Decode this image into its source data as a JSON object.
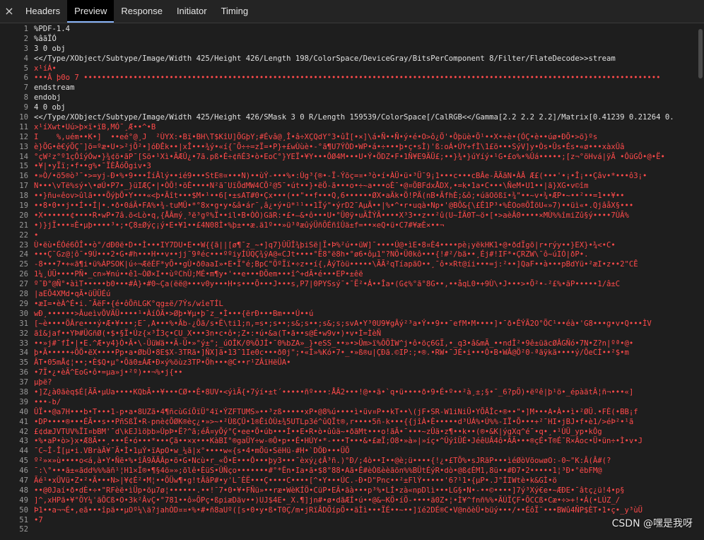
{
  "tabs": {
    "close": "×",
    "headers": "Headers",
    "preview": "Preview",
    "response": "Response",
    "initiator": "Initiator",
    "timing": "Timing"
  },
  "lines": [
    {
      "n": "1",
      "t": "%PDF-1.4"
    },
    {
      "n": "2",
      "t": "%âãÏÓ"
    },
    {
      "n": "3",
      "t": "3 0 obj"
    },
    {
      "n": "4",
      "t": "<</Type/XObject/Subtype/Image/Width 425/Height 426/Length 198/ColorSpace/DeviceGray/BitsPerComponent 8/Filter/FlateDecode>>stream"
    },
    {
      "n": "5",
      "t": "x¹íÁ•",
      "c": "red"
    },
    {
      "n": "6",
      "t": "•••Â þ0o 7 ••••••••••••••••••••••••••••••••••••••••••••••••••••••••••••••••••••••••••••••••••••••••••••••••••••••••••••••••••••••••••••••••",
      "c": "red"
    },
    {
      "n": "7",
      "t": "endstream"
    },
    {
      "n": "8",
      "t": "endobj"
    },
    {
      "n": "9",
      "t": "4 0 obj"
    },
    {
      "n": "10",
      "t": "<</Type/XObject/Subtype/Image/Width 425/Height 426/SMask 3 0 R/Length 159539/ColorSpace[/CalRGB<</Gamma[2.2 2.2 2.2]/Matrix[0.41239 0.21264 0."
    },
    {
      "n": "11",
      "t": "x¹íXwt•Uú>þ×ï•ïB,MÓ¯¸Æ••^•B",
      "c": "red"
    },
    {
      "n": "12",
      "t": "I    %,uém••K•]  ••eé°@¸J  ²ÙYX:•Bï•BH\\T$KîU]ÕGþY;#Évâ@¸Î•â÷XÇQdY°3•ûÌ[•×]\\á•Ñ••Ñ•ý•é•O>ô¿Ö'•Ôþüè•Ö¹••X•+è•{ÓÇ•è••úø•ÐÕ•>ö}ºs",
      "c": "red"
    },
    {
      "n": "13",
      "t": "è}ÕG•ê€ýÕÇ¯]õ=ºæ•U•>²jÕ²•]óÐÊk••|xÎ•••¾ý•«í{¯Õ÷÷=zÏ=•P}+£wÙùè•-°ã¶U7ÝÒD•WP•á•÷•••þ•ç•sÌ)'ß:oÁ•ÚY+fÌ\\1£ö•••SýV]y•Òs•Ûs•És•«ø•••xàxÛâ",
      "c": "red"
    },
    {
      "n": "14",
      "t": "°çW²z°º1çÔîýÓw•}¾¢ö•ãP¯[Sö•¹Xì•ÃÆÛ¿•7ã.pß•É÷¢ñÉ3•ò•EoC°}YEÏ•¥Y•••ÔØ4M•••U•Ý•ÖDZ•F•1Ñ¥E9ÄÜ£;••}¾•}úYíý•¹G•£o%•%Ûá•••••;[z¬°öHvá|ÿÃ •ÔüGÕ•@•Ë•",
      "c": "red"
    },
    {
      "n": "15",
      "t": "•¥|•yÏï;•f••g%•¯ÏÈÅóÕgiv•3",
      "c": "red"
    },
    {
      "n": "16",
      "t": "•»Ò/•ö5®ò³¯•>=yj-Ð•%•9•••ÍíÂlý••ié9•••StE®¤•••N)••ùÝ-•••%•:Ùg³{®•-Ï-Ýõç=¤•³ò•í•ÀÜ•ü•³Ü¯9¡1•••c•••cBÂe-ÃÃãN•ÀÂ Æ£(•••'•¡•Î¡••Çâv•*•••ô3¡•",
      "c": "red"
    },
    {
      "n": "17",
      "t": "N•••\\vTë%sý•\\•øÚ•P7•_}üIÆÇ•|•ÒÕ!•öÈ••••N²ã¯UïÕdMW4CÕ²@5¯•út••}•ëÖ-ã•••o•÷~a•••oÈ¯•@¤ÕBFdxÅDX,•=k•1a•C•••\\ÑeM•U1••|ã}XG•v©îm",
      "c": "red"
    },
    {
      "n": "18",
      "t": "••}ñu«êov>ûlã•••ÕýþÕ•Y•••«<þ•Ãît•••$M•¹••6[•±sAT#0•Çx•••(••\"••f•••Q,6••••••ØX•aÄk•Ö!PÄ(nB•ÃfhÈ;&ô;•úãOõßï•¾\"••~v•¾•ÆP•~••²••=1••¥••",
      "c": "red"
    },
    {
      "n": "19",
      "t": "••8•0••j••Í••Í|•.•ð•0áÃ•FA%•¾-tuMÜ•*°8x•g•y•&â•ár¯,â¿•ý•ü*¹¹••1Ïý\"•ýrD2¯AµÄ••|%•^•r•uqà•Np•'@BÕ&{\\£Ê1P³•%ÈOo®ÕÎõU«»7)••üì«•.QjâåX§•••",
      "c": "red"
    },
    {
      "n": "20",
      "t": "•X••••••¢••••R•wP•7â.õ<Lò•q,{ÅÂmý¸³ë³gº%Ï••il•B•ÒÒ)GãR:•£•–&•ô•••U•°Ü0ÿ•uÃÎÝÃ••••X³3••z••²û(U~ÍÃ0T~ö•[•>aèÂ0••••×MÙ%%îmiZû§ý••••7ÙÃ%",
      "c": "red"
    },
    {
      "n": "21",
      "t": "•)}jÏ•••¤È•µþ••••³•;•Ç8±Øýç¡ý•E•¥1••£4N08Ì•%þ±••æ.ä1º••»ü³ªæûýÜñÕÉñîÛä±f=••×eQ•ü•C7#¥æÈ×••¬",
      "c": "red"
    },
    {
      "n": "22",
      "t": "•",
      "c": "red"
    },
    {
      "n": "23",
      "t": "Ù•ëù•ÉÓé6ÔÎ••ò°/dÐ0ë•D••Ì•••IY7DU•E••W{{ã||[ø¶¯z_~•]q7}ÛÜÎ¾þiSë|Ï•Þ%²ú••üW]¯••••Ú@•ìE•8¤È4••••pè¡yëkHK1•@•ðdÏgõ|r•rýy••}EX}•¾<•C•",
      "c": "red"
    },
    {
      "n": "24",
      "t": "•••Ç¯Gz@¦ô¯•9Ú•••2•G•#h•••H••v••jj¯9ªéc•••ººiyÍÚQÇ¾ÿA@«CJt••••°Ë8°ë8h•°ø6•ôµ1\"?NÖ•Ü0kô•••{!#²/bã••¸Éj#!IF*•ÇRZW\\¯ô~úIÓ|ðP•.",
      "c": "red"
    },
    {
      "n": "25",
      "t": "-8•••7•+«ã¶i•ü%ÀPSOK|ú÷¬ÆëÉF*yÕ••gÙ•ð0aaI»•E•Ï°é;BpC\"ÖºÏï•÷z••í{,ÀýTòü•••••\\ÃÃ²qTíapãO••¸¯ô•×Rt@íi•••=j:²••]QaF••à•••pBdYü•²æI•z••2\"CÊ",
      "c": "red"
    },
    {
      "n": "26",
      "t": "1¼¸ÚÜ••••PÑ•_cn»¥nú••ê1~ÒØ×I••ùºChÛ;MÉ•m¶y•'••e•••ÐÖem•••î^+dÃ•é•••EP•±êë",
      "c": "red"
    },
    {
      "n": "27",
      "t": "º¯Ð°@Ñ°•àìT•••••b0•••#À}•#0~Ça(ëë@•••v0y•••H•s•••Ö•••J•••s,P7|0PYSsý¯•¯Ë²•Á••Îa•(G¢%°ã°8G••,••åqL0•+9Ù\\•J•••>•Õ²•-²£%•ãP•••••1/â±C",
      "c": "red"
    },
    {
      "n": "28",
      "t": "|aEÕ4XMd•qÃ•üÜÜÉú",
      "c": "red"
    },
    {
      "n": "29",
      "t": "•æI=•èÀ^É•i.¯ÃëF•{é•ôÕñLGK°qg±ë/7Ýs/wîeTÍL",
      "c": "red"
    },
    {
      "n": "30",
      "t": "wÐ¸••••••>ÂueìvÕVÄÜ••••¹•ÀíÓÃ•>Øþ•¥µ•þ¯z_•Ì•••{ërÐ•••Bm•••Ú••ú",
      "c": "red"
    },
    {
      "n": "31",
      "t": "[~è••••ÖÂre•••ý•Æ•¥•••;E¯,A•••%•Ãb-¿Õã/s•Ë\\ti1;n,=s•;s••;s&;s••;s&;s;svA•Y³0U9¥gÂý²³a•Ý••9••¯efM•M••••]•¯ð•ÊÝÃ2O°ÕC¹••éà•'G8•••g•v•Q•••ÌV",
      "c": "red"
    },
    {
      "n": "32",
      "t": "ãî&jaf••YÞ#ÜGñØ(•$•§Ï•Úz{×³Î3ç•CU_X•••3n•c•ô•;Z•:•ú•&a(T•ã••s@É•w9v•)•v•Ì=ÌèÑ",
      "c": "red"
    },
    {
      "n": "33",
      "t": "••»j#¯fÍ•|•E.^Æ•y4}Ò•Ã•\\-ÜüWä••Ã-Ü•»°ý±°;_úOÎK/0%ÖJÍ•¯0%bZA»_}•eSS_••»•>Üm>ï%ÔÕÌW^j•ô•öç6GÏ,•_q3•â&mÃ_••ndÎ²•9ê±üãcØÂGÑó•7N•Z?n|ºª•@•",
      "c": "red"
    },
    {
      "n": "34",
      "t": "þ•Ã•••••+ÖÖ•ëX••••Pp•a•ØbÜ•8E$X-3TRä•]ÑX]ã•13¯1Ie0c•••ð0j\";•«Î»%Kó•7•_•»ß®u|ÇÐã.©IP:;•®.•RW•¯JÉ•i•••Ô•B•WÂ@Ö²0-ªäÿkä••••ý/ÕeCÍ••²$•m",
      "c": "red"
    },
    {
      "n": "35",
      "t": "ÂT•05mÅ¢¦••;•È$Q•µ°•Õä0±ÁÆ•Ð×ý%öùz3TP•Öh•••@C••r¹ZÂïHëÜA•",
      "c": "red"
    },
    {
      "n": "36",
      "t": "•7Ï•¿•èÃ^EoG•ô•=µa»j•²º)••¬%•j{••",
      "c": "red"
    },
    {
      "n": "37",
      "t": "µþë?",
      "c": "red"
    },
    {
      "n": "38",
      "t": "•]Z¿à0ãèq$É[ÃÃ•µUa••••KQbÃ••¥•••CØ••È•8UV•<ýìÄ{•7ýí•±t´•••••ñº•••:ÅÂ2•••!@••ã•`q•ü••••ð•9•É•º••²à¸±;§•¯_6?pÖ)•ëºê|þ¹ö•_épàãtÂ¦ñ¬•••«]",
      "c": "red"
    },
    {
      "n": "39",
      "t": "•••-b/",
      "c": "red"
    },
    {
      "n": "40",
      "t": "ÛÏ••@a7H•••b•T•••1-p•a•8UZã•4¶ñcùGíÖïÜ°4ï•ÝZFTUMS»••³zß•••••xP•@8%ú••••ì•üv¤P••kT••\\(jF•SR-W1iNiÜ•YÕÂÎc•®••\"•]M•••A•À••ì•²ØÜ.•FÈ(•BB¡f",
      "c": "red"
    },
    {
      "n": "41",
      "t": "•DP••••®•••ÉÃ••s••PñSßÏ•R-pnè¢ÕØK®èç¿•»>~•²ÙßÇÛ•1®ÊiÒÙ±¾5UTLp3é^ûQÏt®,r••••5ñ-k•••{{jîÀ•È•••••d³ÚÁ%•Ú%%-IÏ•Õ•••+²¯HI•jBJ•f•è1/>éÞ²•¹ã",
      "c": "red"
    },
    {
      "n": "42",
      "t": "£¢dæJVTUV%ÏI¤bBM'¯d\\kEJìöþb»ÙpÞ•Ë?^ã;éÃ¤yÕý°Ç•ee•Ö•úb•••Í••E•R•ò•ûûä~•ðãMt•••o!ãÃ•¯•••~zÛä•z¶••k••(®•&K|ýgXq^é¯•q•¸•¹ÙÜ_yp•kÔg",
      "c": "red"
    },
    {
      "n": "43",
      "t": "•%•aP•ò>}x•Æ8Ã••¸•••É•ó•••*•••Çã••×x•••KàBI°®gaÜY÷w-®Ô•p••É•HÚY•*-•••T•••&•£æÏ;O8•»à»|»íç•^ÛýîÜÉ•JéêUÂ4ô•ÃÃ•••®çÉ•T®É¯R×Âoc•Ü•ün÷•Ì•v•J",
      "c": "red"
    },
    {
      "n": "44",
      "t": "¯C~Î-Î[µ•i.VBràÃ¥¯Ã•Ì•1µÝ•ïApO•w_¼ã|x°••••w«{s•4•mÖü•SëHü-#H•`DÖÐ•••ÜÕ",
      "c": "red"
    },
    {
      "n": "45",
      "t": "º²»×»ù••••o<á,à•Y•Ñë•%•îÃ9ÃÄÂp•õ•G•Ncù•r_«Ö•E•••Ô•••þy3•••¯èxý¿¢Â³ñ.)°Ð/;4ò••I••@è;ü••••{!¿•£TÕ%•sJRãP•••ìéØòVõowøO:-0~\"K:Â(Â#(?",
      "c": "red"
    },
    {
      "n": "46",
      "t": "¯:\\°•••ã±«ãdd%%%äñ¹¦H1×Ï®•¶§4ö»»;õlê•ÈüS•ÛÑço•••••••#°*Ën•Ia•ã•$8°88•Aã•Ê#èÒßèèãõn%%BÜtÉýR•dò•@ß¢ÉM1,8ü••#Ð7•2•••••1¦³Ð•°ëbFM@",
      "c": "red"
    },
    {
      "n": "47",
      "t": "Ãé¹•xÜVü•Z•²•Ã•••N>|¥¢É²•M¦••ÕÜw¶•g!tÃâP#•y'L¯ÈË•••Ç••••C••••[^•Y•••ÚC.-Ð•D\"Pnc••²±FlÝ•••••'6?¹1•{µP•.J°ÍIWtè•k&GÌ•ö",
      "c": "red"
    },
    {
      "n": "48",
      "t": "••@0Jaí•ð•dÈ•÷•\"RFèë•ìÜp•öµ7ø¦••••••.••!¯7•0•¥•FÑü»••ræ•WèKÍÖ•CüP•EÃ•ãà•••p³%•LÍ•zà«npDlì•••LG§•N•-••©••••]7ý³Xý€e•~ÆÐE•¯âtç¿ü!4•p§",
      "c": "red"
    },
    {
      "n": "49",
      "t": "]^,xHPã•¥°ÕY¼'ãÕCß•O•3k²ÂvÇ•°781••ô»ÕPç•ßpiæDäv••)UJ$4E•_X.¶]jn#•ø•dãÆÍ•ú••@&~KÖ•íÖ-••••ä0Z•¦•Ì¥^fnñ%%•ÃÚÏÇF•ÕCCß•Cæ•÷>+!•Á(•LÚZ_/",
      "c": "red"
    },
    {
      "n": "50",
      "t": "Þ1••a¬¬É•,eã•••îpä••µOº¼\\ä?jahÒD¤¤•%•#•ñ8aUº([s•0•y•ß•T0Ç/m•jRïÂDÕípÕ••ãÌì•••ÏÉ••~••]ïé2DÉ®C•V@nõèÛ•büý•••/••ÉôÏ¯•••BWû4ÑP$ÈT•1•ç•_y³ùÜ",
      "c": "red"
    },
    {
      "n": "51",
      "t": "•7",
      "c": "red"
    },
    {
      "n": "52",
      "t": "",
      "c": "red"
    }
  ],
  "watermark": "CSDN @嘿是我呀"
}
